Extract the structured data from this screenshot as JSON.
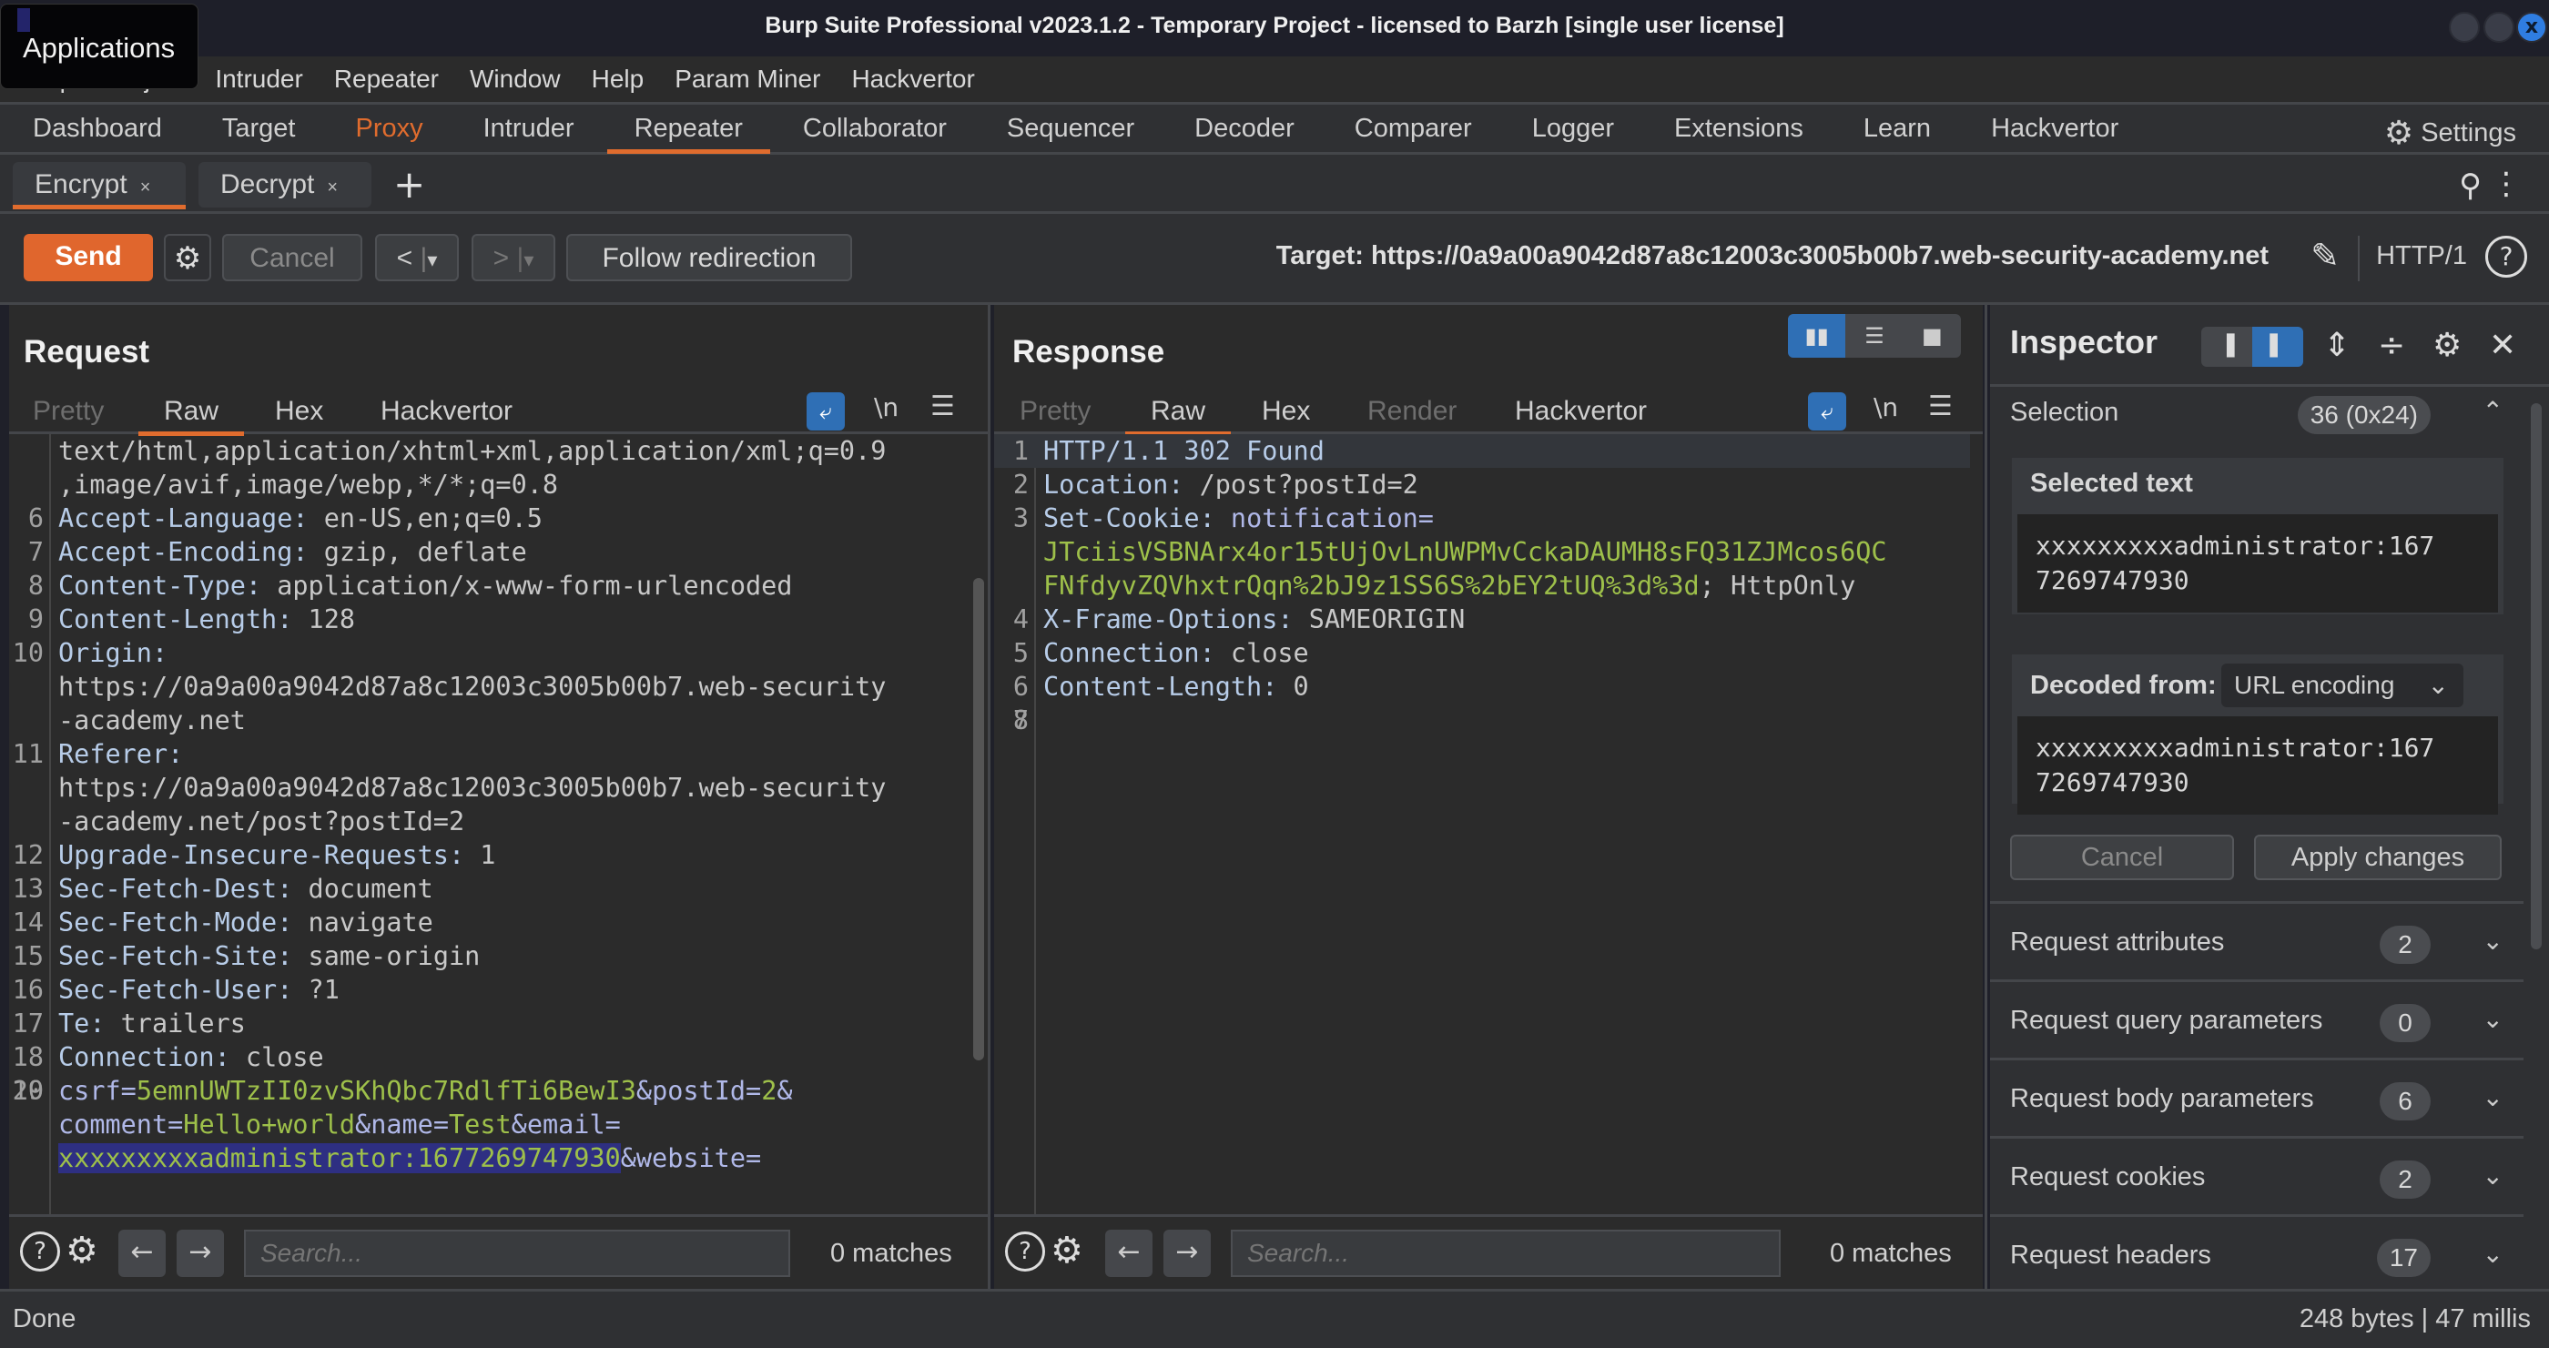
{
  "window": {
    "title": "Burp Suite Professional v2023.1.2 - Temporary Project - licensed to Barzh [single user license]",
    "applications_tooltip": "Applications"
  },
  "menu": [
    "Burp",
    "Project",
    "Intruder",
    "Repeater",
    "Window",
    "Help",
    "Param Miner",
    "Hackvertor"
  ],
  "main_tabs": [
    "Dashboard",
    "Target",
    "Proxy",
    "Intruder",
    "Repeater",
    "Collaborator",
    "Sequencer",
    "Decoder",
    "Comparer",
    "Logger",
    "Extensions",
    "Learn",
    "Hackvertor"
  ],
  "main_tab_active": "Repeater",
  "settings_label": "Settings",
  "sub_tabs": [
    {
      "label": "Encrypt",
      "active": true
    },
    {
      "label": "Decrypt",
      "active": false
    }
  ],
  "toolbar": {
    "send": "Send",
    "cancel": "Cancel",
    "back": "<",
    "forward": ">",
    "dropdown": "▾",
    "follow": "Follow redirection",
    "target": "Target: https://0a9a00a9042d87a8c12003c3005b00b7.web-security-academy.net",
    "http_version": "HTTP/1"
  },
  "request": {
    "title": "Request",
    "tabs": [
      "Pretty",
      "Raw",
      "Hex",
      "Hackvertor"
    ],
    "active_tab": "Raw",
    "lines": [
      {
        "n": "",
        "k": "",
        "v": "text/html,application/xhtml+xml,application/xml;q=0.9"
      },
      {
        "n": "",
        "k": "",
        "v": ",image/avif,image/webp,*/*;q=0.8"
      },
      {
        "n": "6",
        "k": "Accept-Language:",
        "v": " en-US,en;q=0.5"
      },
      {
        "n": "7",
        "k": "Accept-Encoding:",
        "v": " gzip, deflate"
      },
      {
        "n": "8",
        "k": "Content-Type:",
        "v": " application/x-www-form-urlencoded"
      },
      {
        "n": "9",
        "k": "Content-Length:",
        "v": " 128"
      },
      {
        "n": "10",
        "k": "Origin:",
        "v": ""
      },
      {
        "n": "",
        "k": "",
        "v": "https://0a9a00a9042d87a8c12003c3005b00b7.web-security"
      },
      {
        "n": "",
        "k": "",
        "v": "-academy.net"
      },
      {
        "n": "11",
        "k": "Referer:",
        "v": ""
      },
      {
        "n": "",
        "k": "",
        "v": "https://0a9a00a9042d87a8c12003c3005b00b7.web-security"
      },
      {
        "n": "",
        "k": "",
        "v": "-academy.net/post?postId=2"
      },
      {
        "n": "12",
        "k": "Upgrade-Insecure-Requests:",
        "v": " 1"
      },
      {
        "n": "13",
        "k": "Sec-Fetch-Dest:",
        "v": " document"
      },
      {
        "n": "14",
        "k": "Sec-Fetch-Mode:",
        "v": " navigate"
      },
      {
        "n": "15",
        "k": "Sec-Fetch-Site:",
        "v": " same-origin"
      },
      {
        "n": "16",
        "k": "Sec-Fetch-User:",
        "v": " ?1"
      },
      {
        "n": "17",
        "k": "Te:",
        "v": " trailers"
      },
      {
        "n": "18",
        "k": "Connection:",
        "v": " close"
      },
      {
        "n": "19",
        "k": "",
        "v": ""
      }
    ],
    "body": {
      "line_number": "20",
      "params": [
        {
          "name": "csrf",
          "value": "5emnUWTzII0zvSKhQbc7RdlfTi6BewI3"
        },
        {
          "name": "postId",
          "value": "2"
        },
        {
          "name": "comment",
          "value": "Hello+world"
        },
        {
          "name": "name",
          "value": "Test"
        },
        {
          "name": "email",
          "value": "xxxxxxxxxadministrator:1677269747930",
          "selected": true
        },
        {
          "name": "website",
          "value": ""
        }
      ]
    },
    "search_placeholder": "Search...",
    "matches": "0 matches"
  },
  "response": {
    "title": "Response",
    "tabs": [
      "Pretty",
      "Raw",
      "Hex",
      "Render",
      "Hackvertor"
    ],
    "active_tab": "Raw",
    "status_line": "HTTP/1.1 302 Found",
    "location": {
      "k": "Location:",
      "v": " /post?postId=2"
    },
    "set_cookie": {
      "k": "Set-Cookie:",
      "name": " notification=",
      "value_part1": "JTciisVSBNArx4or15tUjOvLnUWPMvCckaDAUMH8sFQ31ZJMcos6QC",
      "value_part2": "FNfdyvZQVhxtrQqn%2bJ9z1SS6S%2bEY2tUQ%3d%3d",
      "suffix": "; HttpOnly"
    },
    "headers": [
      {
        "n": "4",
        "k": "X-Frame-Options:",
        "v": " SAMEORIGIN"
      },
      {
        "n": "5",
        "k": "Connection:",
        "v": " close"
      },
      {
        "n": "6",
        "k": "Content-Length:",
        "v": " 0"
      },
      {
        "n": "7",
        "k": "",
        "v": ""
      },
      {
        "n": "8",
        "k": "",
        "v": ""
      }
    ],
    "search_placeholder": "Search...",
    "matches": "0 matches"
  },
  "inspector": {
    "title": "Inspector",
    "selection_label": "Selection",
    "selection_badge": "36 (0x24)",
    "selected_text_label": "Selected text",
    "selected_text": "xxxxxxxxxadministrator:167\n7269747930",
    "decoded_from_label": "Decoded from:",
    "decoded_from_value": "URL encoding",
    "decoded_text": "xxxxxxxxxadministrator:167\n7269747930",
    "cancel": "Cancel",
    "apply": "Apply changes",
    "sections": [
      {
        "label": "Request attributes",
        "count": "2"
      },
      {
        "label": "Request query parameters",
        "count": "0"
      },
      {
        "label": "Request body parameters",
        "count": "6"
      },
      {
        "label": "Request cookies",
        "count": "2"
      },
      {
        "label": "Request headers",
        "count": "17"
      }
    ]
  },
  "status": {
    "left": "Done",
    "right": "248 bytes | 47 millis"
  },
  "colors": {
    "accent": "#e06c2e",
    "selected_blue": "#2f6fb5",
    "param_value": "#9ec04a",
    "selection_highlight": "#2e2f82"
  }
}
